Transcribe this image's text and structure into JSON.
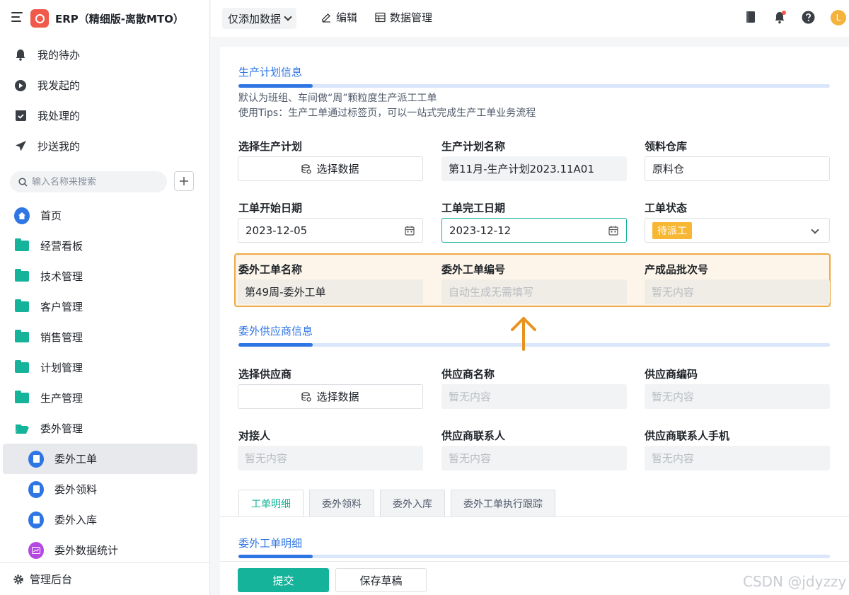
{
  "app": {
    "title": "ERP（精细版-离散MTO）",
    "logo_text": "ERP"
  },
  "quick_nav": [
    {
      "label": "我的待办",
      "icon": "bell-icon"
    },
    {
      "label": "我发起的",
      "icon": "play-circle-icon"
    },
    {
      "label": "我处理的",
      "icon": "inbox-check-icon"
    },
    {
      "label": "抄送我的",
      "icon": "send-icon"
    }
  ],
  "search": {
    "placeholder": "输入名称来搜索"
  },
  "nav": [
    {
      "label": "首页",
      "icon": "home-icon"
    },
    {
      "label": "经营看板",
      "icon": "folder-icon"
    },
    {
      "label": "技术管理",
      "icon": "folder-icon"
    },
    {
      "label": "客户管理",
      "icon": "folder-icon"
    },
    {
      "label": "销售管理",
      "icon": "folder-icon"
    },
    {
      "label": "计划管理",
      "icon": "folder-icon"
    },
    {
      "label": "生产管理",
      "icon": "folder-icon"
    },
    {
      "label": "委外管理",
      "icon": "folder-open-icon"
    },
    {
      "label": "委外工单",
      "icon": "document-icon",
      "active": true
    },
    {
      "label": "委外领料",
      "icon": "document-icon"
    },
    {
      "label": "委外入库",
      "icon": "document-icon"
    },
    {
      "label": "委外数据统计",
      "icon": "chart-icon"
    }
  ],
  "sidebar_footer": {
    "label": "管理后台"
  },
  "toolbar": {
    "view_select": "仅添加数据",
    "edit": "编辑",
    "data_manage": "数据管理",
    "avatar": "L"
  },
  "section1": {
    "title": "生产计划信息",
    "hint1": "默认为班组、车间做“周”颗粒度生产派工工单",
    "hint2": "使用Tips：生产工单通过标签页，可以一站式完成生产工单业务流程"
  },
  "fields": {
    "select_plan": {
      "label": "选择生产计划",
      "value": "选择数据"
    },
    "plan_name": {
      "label": "生产计划名称",
      "value": "第11月-生产计划2023.11A01"
    },
    "warehouse": {
      "label": "领料仓库",
      "value": "原料仓"
    },
    "start_date": {
      "label": "工单开始日期",
      "value": "2023-12-05"
    },
    "end_date": {
      "label": "工单完工日期",
      "value": "2023-12-12"
    },
    "status": {
      "label": "工单状态",
      "value": "待派工"
    },
    "outsource_name": {
      "label": "委外工单名称",
      "value": "第49周-委外工单"
    },
    "outsource_no": {
      "label": "委外工单编号",
      "value": "自动生成无需填写"
    },
    "batch_no": {
      "label": "产成品批次号",
      "value": "暂无内容"
    }
  },
  "section2": {
    "title": "委外供应商信息"
  },
  "supplier": {
    "select": {
      "label": "选择供应商",
      "value": "选择数据"
    },
    "name": {
      "label": "供应商名称",
      "value": "暂无内容"
    },
    "code": {
      "label": "供应商编码",
      "value": "暂无内容"
    },
    "contact": {
      "label": "对接人",
      "value": "暂无内容"
    },
    "supplier_contact": {
      "label": "供应商联系人",
      "value": "暂无内容"
    },
    "supplier_phone": {
      "label": "供应商联系人手机",
      "value": "暂无内容"
    }
  },
  "tabs": [
    "工单明细",
    "委外领料",
    "委外入库",
    "委外工单执行跟踪"
  ],
  "section3": {
    "title": "委外工单明细"
  },
  "actions": {
    "submit": "提交",
    "save_draft": "保存草稿"
  },
  "watermark": "CSDN @jdyzzy",
  "colors": {
    "primary": "#14b39a",
    "accent_blue": "#2f76e5",
    "highlight": "#efa843",
    "status_tag": "#f7b733"
  }
}
